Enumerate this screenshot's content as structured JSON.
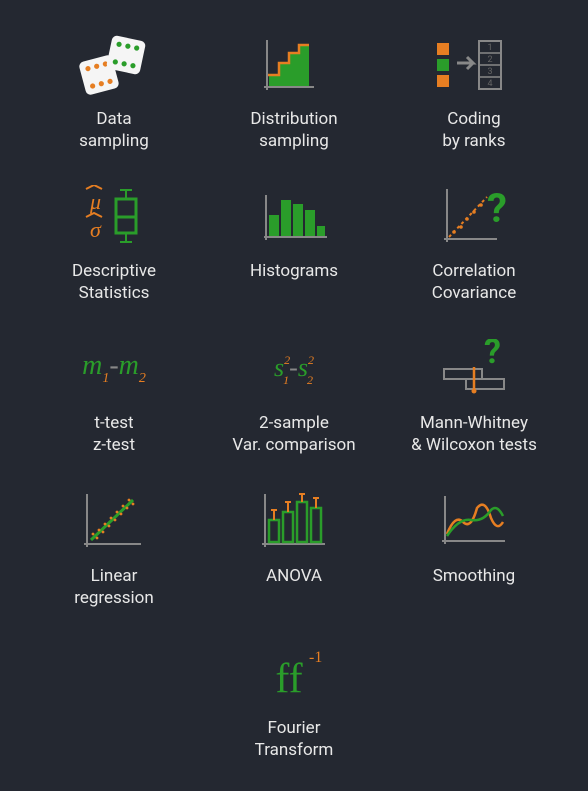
{
  "colors": {
    "green": "#2a9d2a",
    "orange": "#e67e22",
    "grey": "#888888",
    "bg": "#242831",
    "text": "#e8e8e8"
  },
  "tools": [
    {
      "id": "data-sampling",
      "label": "Data\nsampling",
      "icon": "dice"
    },
    {
      "id": "distribution-sampling",
      "label": "Distribution\nsampling",
      "icon": "dist"
    },
    {
      "id": "coding-by-ranks",
      "label": "Coding\nby ranks",
      "icon": "ranks"
    },
    {
      "id": "descriptive-statistics",
      "label": "Descriptive\nStatistics",
      "icon": "desc"
    },
    {
      "id": "histograms",
      "label": "Histograms",
      "icon": "histo"
    },
    {
      "id": "correlation-covariance",
      "label": "Correlation\nCovariance",
      "icon": "corr"
    },
    {
      "id": "t-test-z-test",
      "label": "t-test\nz-test",
      "icon": "ttest"
    },
    {
      "id": "two-sample-var",
      "label": "2-sample\nVar. comparison",
      "icon": "var2"
    },
    {
      "id": "mann-whitney-wilcoxon",
      "label": "Mann-Whitney\n& Wilcoxon tests",
      "icon": "mannw"
    },
    {
      "id": "linear-regression",
      "label": "Linear\nregression",
      "icon": "linreg"
    },
    {
      "id": "anova",
      "label": "ANOVA",
      "icon": "anova"
    },
    {
      "id": "smoothing",
      "label": "Smoothing",
      "icon": "smooth"
    },
    {
      "id": "fourier-transform",
      "label": "Fourier\nTransform",
      "icon": "fourier"
    }
  ]
}
